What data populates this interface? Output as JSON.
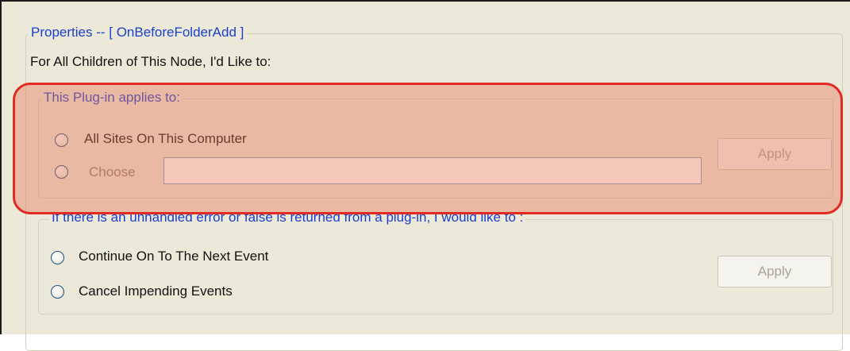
{
  "properties": {
    "legend": "Properties -- [ OnBeforeFolderAdd ]",
    "instruction": "For All Children of This Node, I'd Like to:"
  },
  "plugin_group": {
    "legend": "This Plug-in applies to:",
    "option_all_sites": "All Sites On This Computer",
    "option_choose": "Choose",
    "choose_value": "",
    "apply_label": "Apply"
  },
  "error_group": {
    "legend": "If there is an unhandled error or false is returned from a plug-in, I would like to :",
    "option_continue": "Continue On To The Next Event",
    "option_cancel": "Cancel Impending Events",
    "apply_label": "Apply"
  },
  "colors": {
    "panel_background": "#ece9d8",
    "legend_text": "#1a3fcf",
    "highlight_border": "#e02a24",
    "highlight_fill": "#e8785a"
  }
}
